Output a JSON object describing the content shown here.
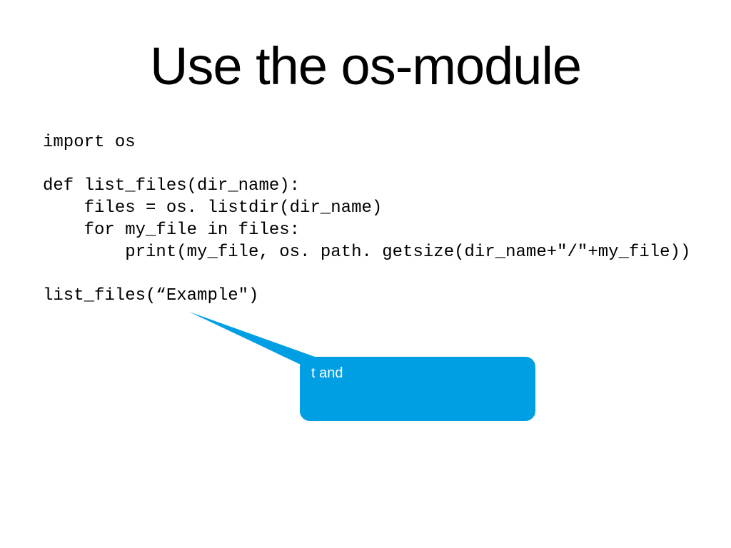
{
  "title": "Use the os-module",
  "code": {
    "line1": "import os",
    "line2": "",
    "line3": "def list_files(dir_name):",
    "line4": "    files = os. listdir(dir_name)",
    "line5": "    for my_file in files:",
    "line6": "        print(my_file, os. path. getsize(dir_name+\"/\"+my_file))",
    "line7": "",
    "line8": "list_files(“Example\")"
  },
  "callout_text": "t and"
}
